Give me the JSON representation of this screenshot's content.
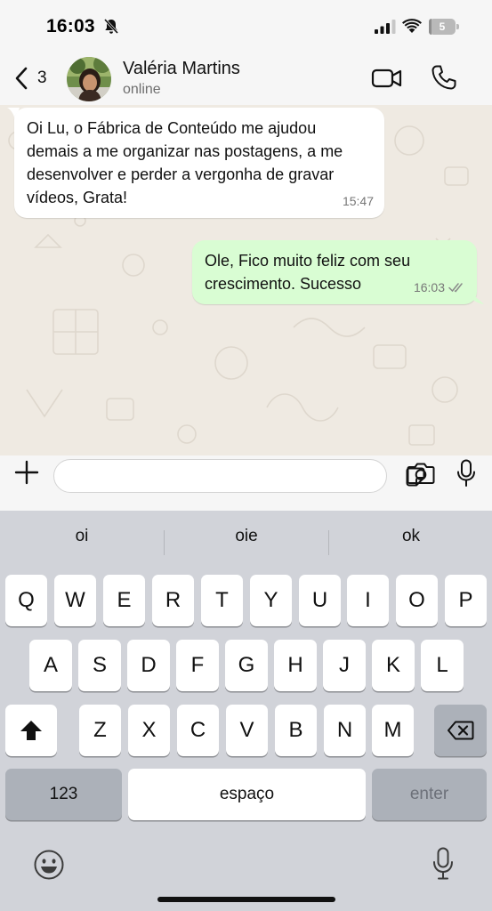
{
  "status_bar": {
    "time": "16:03",
    "battery_level": "5",
    "icons": [
      "bell-slash-icon",
      "cellular-signal-icon",
      "wifi-icon",
      "battery-icon"
    ]
  },
  "chat_header": {
    "back_count": "3",
    "contact_name": "Valéria Martins",
    "contact_status": "online",
    "icons": [
      "chevron-left-icon",
      "video-camera-icon",
      "phone-icon"
    ]
  },
  "messages": [
    {
      "direction": "incoming",
      "text": "Oi Lu, o Fábrica de Conteúdo me ajudou demais a me organizar nas postagens, a me desenvolver e perder a vergonha de gravar vídeos, Grata!",
      "time": "15:47"
    },
    {
      "direction": "outgoing",
      "text": "Ole, Fico muito feliz com seu crescimento. Sucesso",
      "time": "16:03",
      "status": "read"
    }
  ],
  "input_bar": {
    "value": "",
    "placeholder": "",
    "icons": [
      "plus-icon",
      "sticker-icon",
      "camera-icon",
      "microphone-icon"
    ]
  },
  "keyboard": {
    "suggestions": [
      "oi",
      "oie",
      "ok"
    ],
    "row1": [
      "Q",
      "W",
      "E",
      "R",
      "T",
      "Y",
      "U",
      "I",
      "O",
      "P"
    ],
    "row2": [
      "A",
      "S",
      "D",
      "F",
      "G",
      "H",
      "J",
      "K",
      "L"
    ],
    "row3": [
      "Z",
      "X",
      "C",
      "V",
      "B",
      "N",
      "M"
    ],
    "numbers_label": "123",
    "space_label": "espaço",
    "enter_label": "enter",
    "icons": [
      "shift-icon",
      "backspace-icon",
      "emoji-icon",
      "dictation-mic-icon"
    ]
  },
  "colors": {
    "chat_background": "#efeae2",
    "incoming_bubble": "#ffffff",
    "outgoing_bubble": "#d9fdd3",
    "keyboard_background": "#d1d3d9",
    "read_receipt": "#8a8a8a"
  }
}
